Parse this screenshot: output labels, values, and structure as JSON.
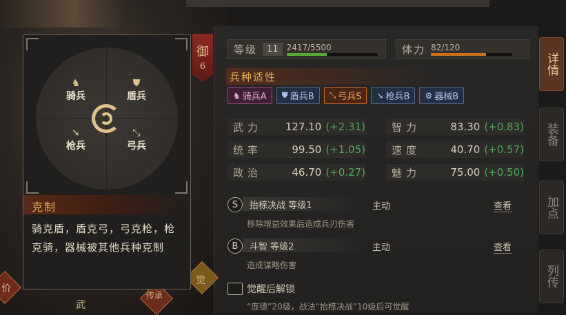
{
  "header": {
    "level_label": "等级",
    "level_value": "11",
    "exp_text": "2417/5500",
    "exp_progress": 0.44,
    "stamina_label": "体力",
    "stamina_text": "82/120",
    "stamina_progress": 0.68
  },
  "troop_suitability": {
    "title": "兵种适性",
    "items": [
      {
        "label": "骑兵A",
        "icon": "horse-icon",
        "bg": "#3d2036",
        "border": "#8a4a7a",
        "color": "#e6a6d6"
      },
      {
        "label": "盾兵B",
        "icon": "shield-icon",
        "bg": "#233044",
        "border": "#4d6a8e",
        "color": "#a9c4e6"
      },
      {
        "label": "弓兵S",
        "icon": "bow-icon",
        "bg": "#4a2414",
        "border": "#c8662a",
        "color": "#f2a66a"
      },
      {
        "label": "枪兵B",
        "icon": "spear-icon",
        "bg": "#233044",
        "border": "#4d6a8e",
        "color": "#a9c4e6"
      },
      {
        "label": "器械B",
        "icon": "gear-icon",
        "bg": "#233044",
        "border": "#4d6a8e",
        "color": "#a9c4e6"
      }
    ]
  },
  "attributes": [
    {
      "name": "武力",
      "value": "127.10",
      "bonus": "(+2.31)"
    },
    {
      "name": "智力",
      "value": "83.30",
      "bonus": "(+0.83)"
    },
    {
      "name": "统率",
      "value": "99.50",
      "bonus": "(+1.05)"
    },
    {
      "name": "速度",
      "value": "40.70",
      "bonus": "(+0.57)"
    },
    {
      "name": "政治",
      "value": "46.70",
      "bonus": "(+0.27)"
    },
    {
      "name": "魅力",
      "value": "75.00",
      "bonus": "(+0.50)"
    }
  ],
  "skills": [
    {
      "grade": "S",
      "name": "抬榇决战 等级1",
      "type": "主动",
      "view": "查看",
      "desc": "移除增益效果后造成兵刃伤害"
    },
    {
      "grade": "B",
      "name": "斗智 等级2",
      "type": "主动",
      "view": "查看",
      "desc": "造成谋略伤害"
    }
  ],
  "awaken": {
    "title": "觉醒后解锁",
    "desc": "“庞德”20级，战法“抬榇决战”10级后可觉醒"
  },
  "side_tabs": [
    {
      "label": "详情",
      "active": true
    },
    {
      "label": "装备",
      "active": false
    },
    {
      "label": "加点",
      "active": false
    },
    {
      "label": "列传",
      "active": false
    }
  ],
  "red_tag": {
    "char": "御",
    "num": "6"
  },
  "counter_popup": {
    "nodes": [
      {
        "label": "骑兵",
        "icon": "horse-icon"
      },
      {
        "label": "盾兵",
        "icon": "shield-icon"
      },
      {
        "label": "枪兵",
        "icon": "spear-icon"
      },
      {
        "label": "弓兵",
        "icon": "bow-icon"
      }
    ],
    "title": "克制",
    "desc": "骑克盾，盾克弓，弓克枪，枪克骑，器械被其他兵种克制"
  },
  "bottom_left": {
    "char1": "价",
    "char2": "武",
    "char3": "传承",
    "char4": "觉"
  }
}
